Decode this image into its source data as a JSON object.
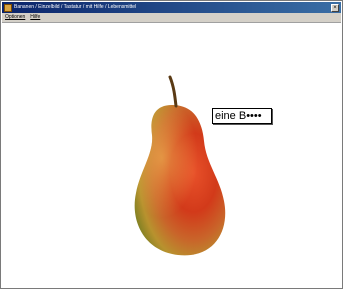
{
  "window": {
    "title": "Bananen / Einzelbild / Tastatur / mit Hilfe / Lebensmittel",
    "buttons": {
      "close": "×"
    }
  },
  "menubar": {
    "items": [
      {
        "label": "Optionen"
      },
      {
        "label": "Hilfe"
      }
    ]
  },
  "content": {
    "image_subject": "pear-image",
    "tooltip_text": "eine B••••"
  },
  "colors": {
    "title_bar": "#0a246a",
    "pear_red": "#d23a1a",
    "pear_yellow": "#d9a82c",
    "pear_green": "#6b7a1f"
  }
}
